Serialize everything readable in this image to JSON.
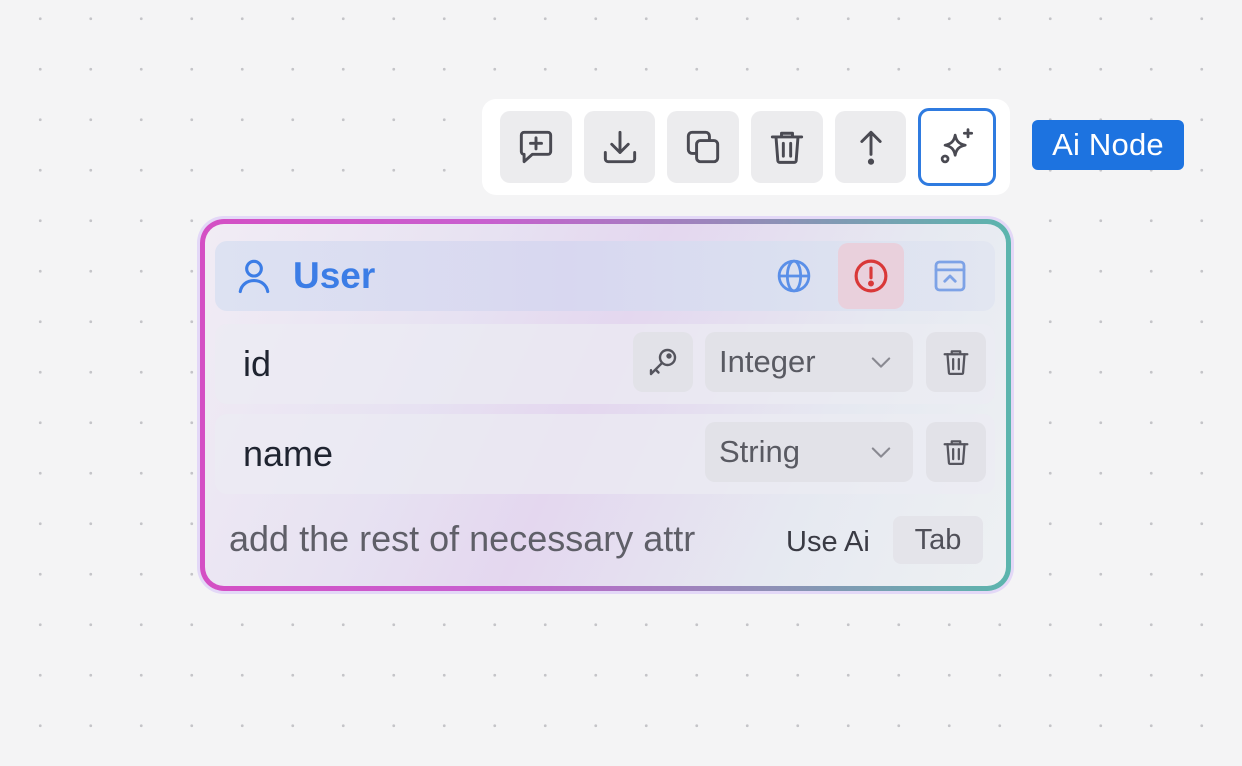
{
  "toolbar": {
    "buttons": [
      {
        "icon": "message-plus-icon",
        "name": "add-comment-button"
      },
      {
        "icon": "download-icon",
        "name": "download-button"
      },
      {
        "icon": "copy-icon",
        "name": "duplicate-button"
      },
      {
        "icon": "trash-icon",
        "name": "delete-node-button"
      },
      {
        "icon": "arrow-up-icon",
        "name": "move-up-button"
      },
      {
        "icon": "sparkles-icon",
        "name": "ai-button",
        "active": true
      }
    ]
  },
  "badge": {
    "label": "Ai Node"
  },
  "node": {
    "title": "User",
    "icon": "user-icon",
    "header_actions": [
      "globe-icon",
      "alert-circle-icon",
      "collapse-icon"
    ],
    "attributes": [
      {
        "name": "id",
        "type": "Integer",
        "primary_key": true
      },
      {
        "name": "name",
        "type": "String",
        "primary_key": false
      }
    ],
    "prompt": {
      "placeholder": "add the rest of necessary attr",
      "hint_label": "Use Ai",
      "key_label": "Tab"
    }
  },
  "colors": {
    "accent": "#1d73e0",
    "title_blue": "#3c7de6",
    "warning_red": "#d93838",
    "border_gradient": [
      "#d44fc4",
      "#5bb5ad"
    ]
  }
}
